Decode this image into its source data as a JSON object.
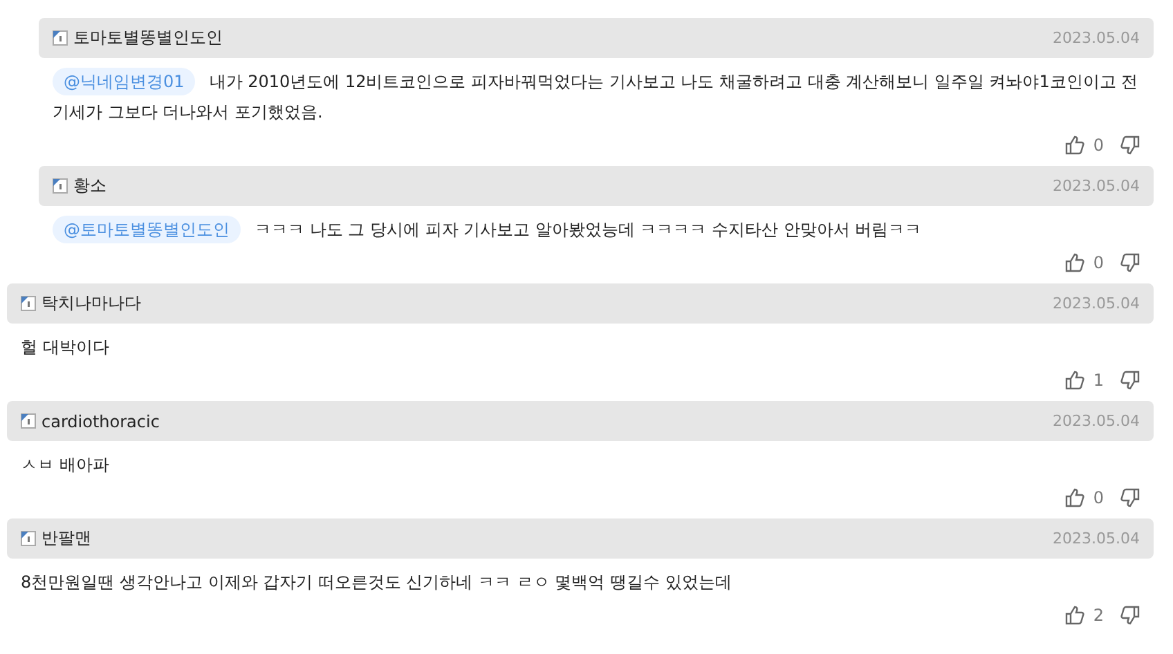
{
  "comments": [
    {
      "kind": "reply",
      "author": "토마토별똥별인도인",
      "date": "2023.05.04",
      "mention": "@닉네임변경01",
      "text": "내가 2010년도에 12비트코인으로 피자바꿔먹었다는 기사보고 나도 채굴하려고 대충 계산해보니 일주일 켜놔야1코인이고 전기세가 그보다 더나와서 포기했었음.",
      "likes": "0"
    },
    {
      "kind": "reply",
      "author": "황소",
      "date": "2023.05.04",
      "mention": "@토마토별똥별인도인",
      "text": "ㅋㅋㅋ 나도 그 당시에 피자 기사보고 알아봤었능데 ㅋㅋㅋㅋ 수지타산 안맞아서 버림ㅋㅋ",
      "likes": "0"
    },
    {
      "kind": "comment",
      "author": "탁치나마나다",
      "date": "2023.05.04",
      "text": "헐 대박이다",
      "likes": "1"
    },
    {
      "kind": "comment",
      "author": "cardiothoracic",
      "date": "2023.05.04",
      "text": "ㅅㅂ 배아파",
      "likes": "0"
    },
    {
      "kind": "comment",
      "author": "반팔맨",
      "date": "2023.05.04",
      "text": "8천만원일땐 생각안나고 이제와 갑자기 떠오른것도 신기하네 ㅋㅋ ㄹㅇ 몇백억 땡길수 있었는데",
      "likes": "2"
    }
  ]
}
